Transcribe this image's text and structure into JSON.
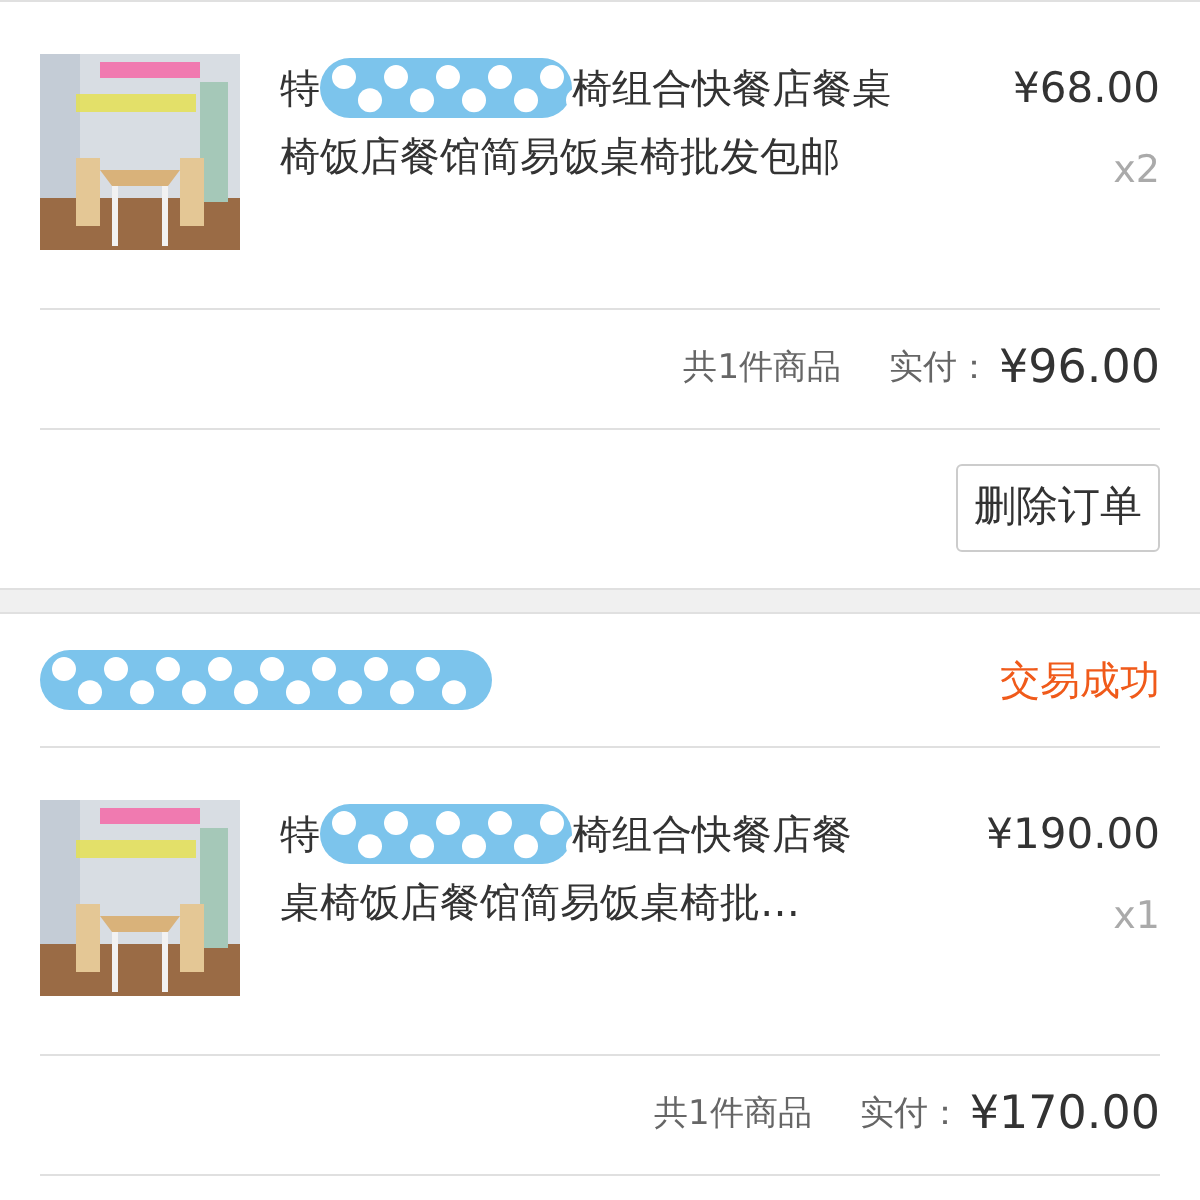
{
  "orders": [
    {
      "items": [
        {
          "kind": "picture",
          "title_lines": [
            {
              "start": "特",
              "redacted": true,
              "end": "椅组合快餐店餐桌"
            },
            {
              "start": "椅饭店餐馆简易饭桌椅批发包邮",
              "redacted": false
            }
          ],
          "price": "¥68.00",
          "quantity": "x2"
        }
      ],
      "count": "共1件商品",
      "paid_label": "实付：",
      "paid": "¥96.00",
      "buttons": [
        "删除订单"
      ]
    },
    {
      "header": {
        "shop_redacted": true,
        "status": "交易成功"
      },
      "items": [
        {
          "kind": "picture",
          "title_lines": [
            {
              "start": "特",
              "redacted": true,
              "end": "椅组合快餐店餐"
            },
            {
              "start": "桌椅饭店餐馆简易饭桌椅批…",
              "redacted": false
            }
          ],
          "price": "¥190.00",
          "quantity": "x1"
        }
      ],
      "count": "共1件商品",
      "paid_label": "实付：",
      "paid": "¥170.00"
    }
  ]
}
